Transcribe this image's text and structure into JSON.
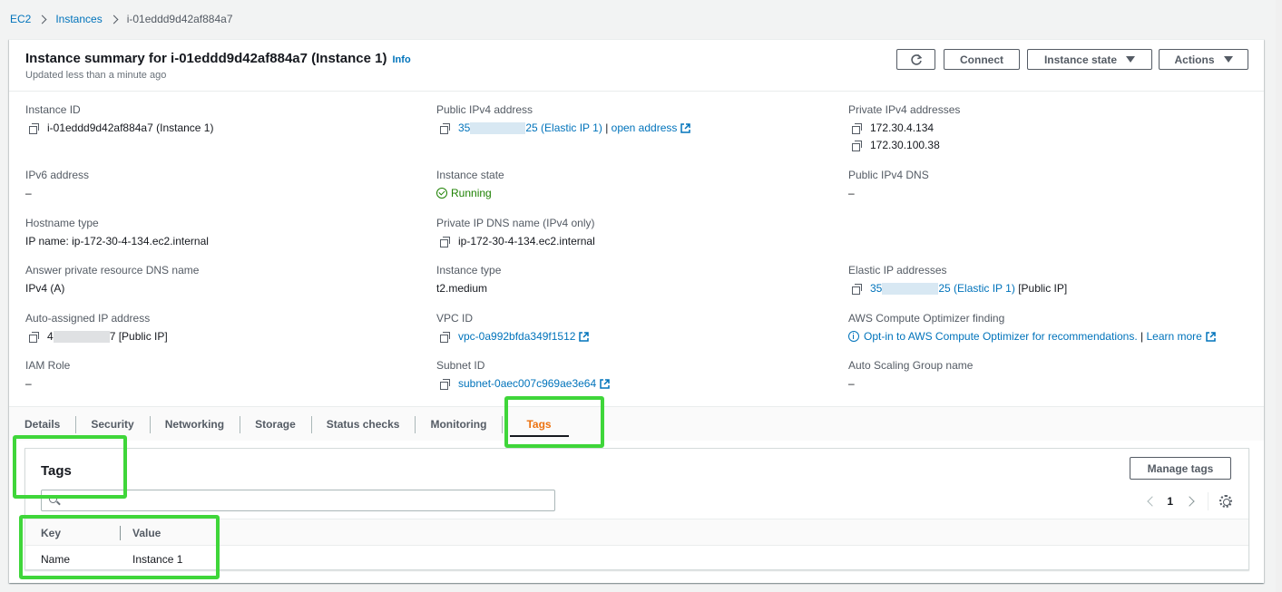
{
  "breadcrumb": {
    "ec2": "EC2",
    "instances": "Instances",
    "current": "i-01eddd9d42af884a7"
  },
  "header": {
    "title": "Instance summary for i-01eddd9d42af884a7 (Instance 1)",
    "info": "Info",
    "subtitle": "Updated less than a minute ago",
    "connect": "Connect",
    "instance_state": "Instance state",
    "actions": "Actions"
  },
  "details": {
    "instance_id": {
      "label": "Instance ID",
      "value": "i-01eddd9d42af884a7 (Instance 1)"
    },
    "ipv6": {
      "label": "IPv6 address",
      "value": "–"
    },
    "hostname_type": {
      "label": "Hostname type",
      "value": "IP name: ip-172-30-4-134.ec2.internal"
    },
    "answer_dns": {
      "label": "Answer private resource DNS name",
      "value": "IPv4 (A)"
    },
    "auto_ip": {
      "label": "Auto-assigned IP address",
      "prefix": "4",
      "suffix": "7 [Public IP]"
    },
    "iam_role": {
      "label": "IAM Role",
      "value": "–"
    },
    "public_ipv4": {
      "label": "Public IPv4 address",
      "prefix": "35",
      "suffix": "25 (Elastic IP 1)",
      "sep": "|",
      "open": "open address"
    },
    "instance_state": {
      "label": "Instance state",
      "value": "Running"
    },
    "private_dns": {
      "label": "Private IP DNS name (IPv4 only)",
      "value": "ip-172-30-4-134.ec2.internal"
    },
    "instance_type": {
      "label": "Instance type",
      "value": "t2.medium"
    },
    "vpc_id": {
      "label": "VPC ID",
      "value": "vpc-0a992bfda349f1512"
    },
    "subnet_id": {
      "label": "Subnet ID",
      "value": "subnet-0aec007c969ae3e64"
    },
    "private_ipv4": {
      "label": "Private IPv4 addresses",
      "values": [
        "172.30.4.134",
        "172.30.100.38"
      ]
    },
    "public_dns": {
      "label": "Public IPv4 DNS",
      "value": "–"
    },
    "elastic_ips": {
      "label": "Elastic IP addresses",
      "prefix": "35",
      "suffix": "25 (Elastic IP 1)",
      "tail": "[Public IP]"
    },
    "optimizer": {
      "label": "AWS Compute Optimizer finding",
      "link": "Opt-in to AWS Compute Optimizer for recommendations.",
      "sep": "|",
      "learn": "Learn more"
    },
    "asg": {
      "label": "Auto Scaling Group name",
      "value": "–"
    }
  },
  "tabs": [
    "Details",
    "Security",
    "Networking",
    "Storage",
    "Status checks",
    "Monitoring",
    "Tags"
  ],
  "active_tab": "Tags",
  "tags": {
    "title": "Tags",
    "manage": "Manage tags",
    "page": "1",
    "columns": [
      "Key",
      "Value"
    ],
    "rows": [
      {
        "key": "Name",
        "value": "Instance 1"
      }
    ]
  },
  "colors": {
    "link": "#0073bb",
    "running": "#1d8102",
    "active_tab": "#ec7211",
    "highlight": "#3fd63a"
  }
}
